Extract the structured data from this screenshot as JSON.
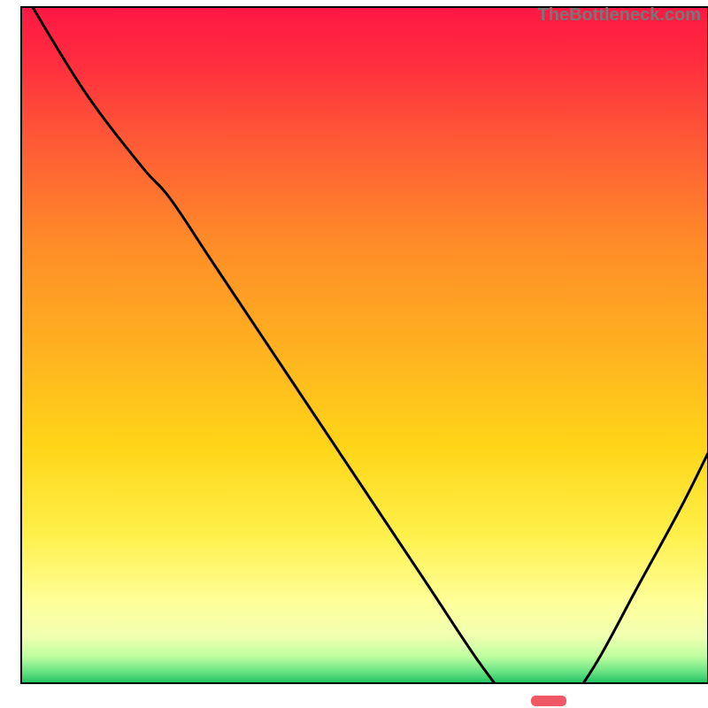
{
  "watermark": "TheBottleneck.com",
  "chart_data": {
    "type": "line",
    "title": "",
    "xlabel": "",
    "ylabel": "",
    "xlim": [
      0,
      100
    ],
    "ylim": [
      0,
      100
    ],
    "gradient_stops": [
      {
        "offset": 0.0,
        "color": "#ff1744"
      },
      {
        "offset": 0.08,
        "color": "#ff2d3f"
      },
      {
        "offset": 0.2,
        "color": "#ff5a36"
      },
      {
        "offset": 0.35,
        "color": "#ff8c28"
      },
      {
        "offset": 0.5,
        "color": "#ffb020"
      },
      {
        "offset": 0.65,
        "color": "#ffd518"
      },
      {
        "offset": 0.78,
        "color": "#fff04a"
      },
      {
        "offset": 0.88,
        "color": "#ffff9a"
      },
      {
        "offset": 0.93,
        "color": "#f0ffb0"
      },
      {
        "offset": 0.96,
        "color": "#c0ffa0"
      },
      {
        "offset": 0.985,
        "color": "#60e080"
      },
      {
        "offset": 1.0,
        "color": "#20c060"
      }
    ],
    "series": [
      {
        "name": "bottleneck-curve",
        "color": "#000000",
        "type": "curve",
        "points": [
          {
            "x": 4.0,
            "y": 100.0
          },
          {
            "x": 12.0,
            "y": 87.0
          },
          {
            "x": 20.0,
            "y": 76.5
          },
          {
            "x": 24.0,
            "y": 72.0
          },
          {
            "x": 30.0,
            "y": 63.0
          },
          {
            "x": 40.0,
            "y": 48.0
          },
          {
            "x": 50.0,
            "y": 33.0
          },
          {
            "x": 60.0,
            "y": 18.0
          },
          {
            "x": 68.0,
            "y": 6.0
          },
          {
            "x": 72.0,
            "y": 1.5
          },
          {
            "x": 76.0,
            "y": 0.8
          },
          {
            "x": 80.0,
            "y": 1.0
          },
          {
            "x": 84.0,
            "y": 6.0
          },
          {
            "x": 90.0,
            "y": 17.0
          },
          {
            "x": 96.0,
            "y": 28.0
          },
          {
            "x": 100.0,
            "y": 36.0
          }
        ]
      }
    ],
    "marker": {
      "x": 77.5,
      "y": 1.0,
      "width": 5.0,
      "color": "#ef5864"
    },
    "frame": {
      "x0": 3.0,
      "y0": 3.5,
      "x1": 100.0,
      "y1": 99.0,
      "stroke": "#000000",
      "stroke_width": 2
    }
  }
}
